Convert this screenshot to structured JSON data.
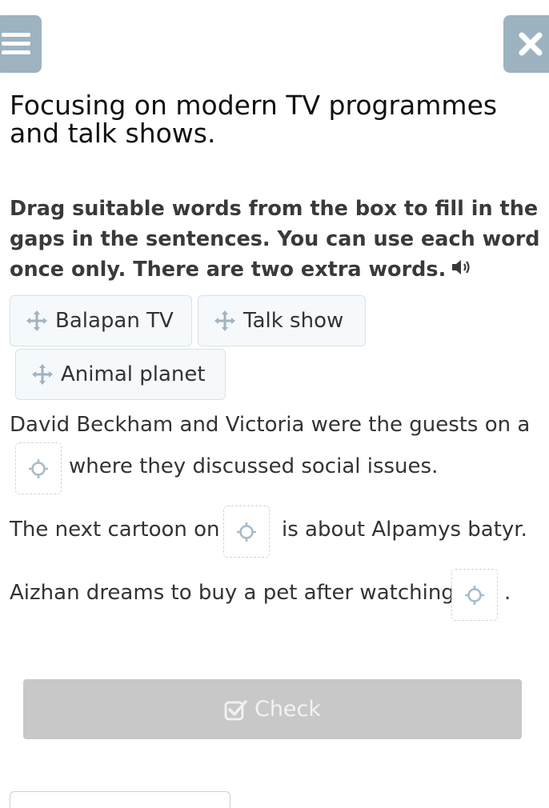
{
  "header": {
    "menu_icon": "hamburger-menu-icon",
    "close_icon": "close-x-icon"
  },
  "task": {
    "title": "Focusing on modern TV programmes and talk shows.",
    "instruction": "Drag suitable words from the box to fill in the gaps in the sentences. You can use each word once only. There are two extra words.",
    "audio_icon": "speaker-icon"
  },
  "word_bank": [
    {
      "label": "Balapan TV"
    },
    {
      "label": "Talk show"
    },
    {
      "label": "Animal planet"
    }
  ],
  "sentences": [
    {
      "line1": "David Beckham and Victoria were the guests on a",
      "after": "where they discussed social issues."
    },
    {
      "before": "The next cartoon on",
      "after": "is about Alpamys batyr."
    },
    {
      "before": "Aizhan dreams to buy a pet after watching",
      "after": "."
    }
  ],
  "actions": {
    "check_label": "Check"
  },
  "colors": {
    "header_button_bg": "#9db4c0",
    "chip_bg": "#f5f9fc",
    "chip_border": "#d7e1e9",
    "gap_border": "#c9d6e0",
    "check_button_bg": "#c8c8c8"
  }
}
